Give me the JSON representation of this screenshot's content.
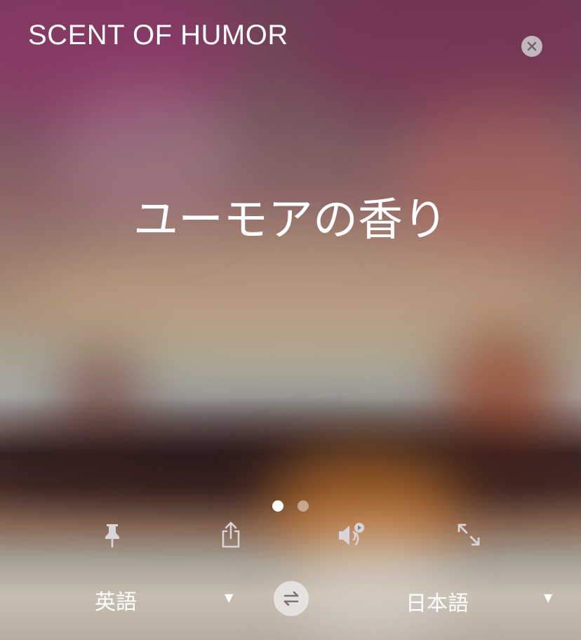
{
  "source_text": "SCENT OF HUMOR",
  "translated_text": "ユーモアの香り",
  "pagination": {
    "total": 2,
    "current": 1
  },
  "actions": {
    "pin_icon": "pin-icon",
    "share_icon": "share-icon",
    "speaker_icon": "speaker-icon",
    "expand_icon": "expand-icon",
    "close_icon": "close-icon"
  },
  "languages": {
    "source": "英語",
    "target": "日本語",
    "swap_icon": "swap-icon"
  },
  "colors": {
    "text": "#ffffff",
    "icon": "#d9d4d6",
    "close_bg": "#d2cdd2",
    "swap_bg": "#ebe8e8"
  }
}
